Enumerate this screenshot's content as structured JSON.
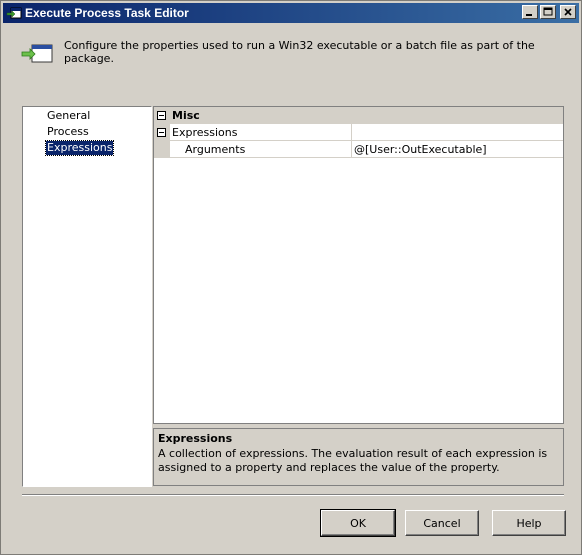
{
  "window": {
    "title": "Execute Process Task Editor"
  },
  "header": {
    "description": "Configure the properties used to run a Win32 executable or a batch file as part of the package."
  },
  "nav": {
    "items": [
      {
        "label": "General",
        "selected": false
      },
      {
        "label": "Process",
        "selected": false
      },
      {
        "label": "Expressions",
        "selected": true
      }
    ]
  },
  "grid": {
    "category": "Misc",
    "group_name": "Expressions",
    "property_name": "Arguments",
    "property_value": "@[User::OutExecutable]"
  },
  "description_panel": {
    "title": "Expressions",
    "body": "A collection of expressions. The evaluation result of each expression is assigned to a property and replaces the value of the property."
  },
  "buttons": {
    "ok": "OK",
    "cancel": "Cancel",
    "help": "Help"
  },
  "colors": {
    "titlebar_start": "#0a246a",
    "titlebar_end": "#3a6ea5",
    "face": "#d4d0c8",
    "selection": "#0a246a"
  }
}
